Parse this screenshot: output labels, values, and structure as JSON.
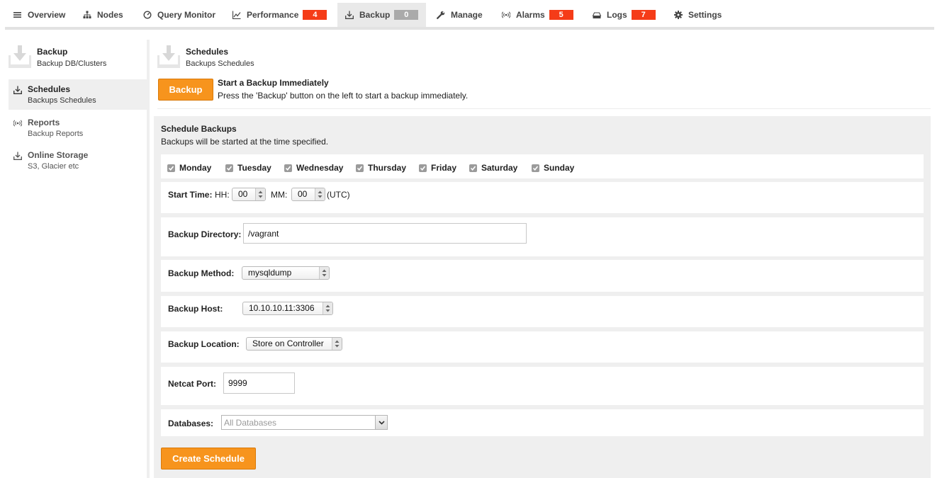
{
  "nav": {
    "tabs": [
      {
        "label": "Overview",
        "icon": "menu-icon"
      },
      {
        "label": "Nodes",
        "icon": "sitemap-icon"
      },
      {
        "label": "Query Monitor",
        "icon": "dashboard-icon"
      },
      {
        "label": "Performance",
        "icon": "line-chart-icon",
        "badge": "4"
      },
      {
        "label": "Backup",
        "icon": "download-icon",
        "badge": "0",
        "active": true
      },
      {
        "label": "Manage",
        "icon": "wrench-icon"
      },
      {
        "label": "Alarms",
        "icon": "broadcast-icon",
        "badge": "5"
      },
      {
        "label": "Logs",
        "icon": "drive-icon",
        "badge": "7"
      },
      {
        "label": "Settings",
        "icon": "gear-icon"
      }
    ]
  },
  "sidebar": {
    "header": {
      "title": "Backup",
      "subtitle": "Backup DB/Clusters"
    },
    "items": [
      {
        "label": "Schedules",
        "sub": "Backups Schedules",
        "icon": "download-icon",
        "active": true
      },
      {
        "label": "Reports",
        "sub": "Backup Reports",
        "icon": "broadcast-icon"
      },
      {
        "label": "Online Storage",
        "sub": "S3, Glacier etc",
        "icon": "download-icon"
      }
    ]
  },
  "main": {
    "header": {
      "title": "Schedules",
      "subtitle": "Backups Schedules"
    },
    "backup_button": "Backup",
    "start_title": "Start a Backup Immediately",
    "start_desc": "Press the 'Backup' button on the left to start a backup immediately."
  },
  "schedule": {
    "title": "Schedule Backups",
    "desc": "Backups will be started at the time specified.",
    "days": [
      {
        "label": "Monday",
        "checked": true
      },
      {
        "label": "Tuesday",
        "checked": true
      },
      {
        "label": "Wednesday",
        "checked": true
      },
      {
        "label": "Thursday",
        "checked": true
      },
      {
        "label": "Friday",
        "checked": true
      },
      {
        "label": "Saturday",
        "checked": true
      },
      {
        "label": "Sunday",
        "checked": true
      }
    ],
    "start_time": {
      "label": "Start Time:",
      "hh_label": "HH:",
      "hh": "00",
      "mm_label": "MM:",
      "mm": "00",
      "tz": "(UTC)"
    },
    "directory": {
      "label": "Backup Directory:",
      "value": "/vagrant"
    },
    "method": {
      "label": "Backup Method:",
      "value": "mysqldump"
    },
    "host": {
      "label": "Backup Host:",
      "value": "10.10.10.11:3306"
    },
    "location": {
      "label": "Backup Location:",
      "value": "Store on Controller"
    },
    "netcat": {
      "label": "Netcat Port:",
      "value": "9999"
    },
    "databases": {
      "label": "Databases:",
      "placeholder": "All Databases"
    },
    "create_button": "Create Schedule"
  },
  "colors": {
    "accent": "#f7941d",
    "badge_red": "#f53c18",
    "badge_gray": "#aaaaaa"
  }
}
